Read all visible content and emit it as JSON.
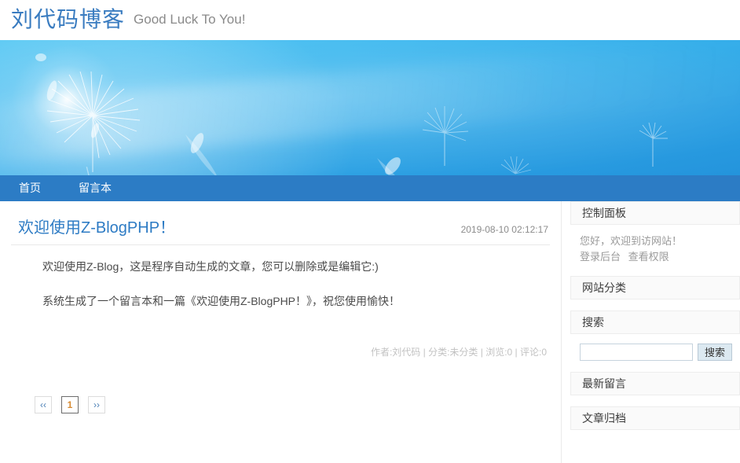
{
  "header": {
    "site_title": "刘代码博客",
    "site_subtitle": "Good Luck To You!"
  },
  "nav": {
    "items": [
      {
        "label": "首页",
        "name": "nav-item-home"
      },
      {
        "label": "留言本",
        "name": "nav-item-guestbook"
      }
    ]
  },
  "article": {
    "title": "欢迎使用Z-BlogPHP！",
    "date": "2019-08-10 02:12:17",
    "paragraphs": [
      "欢迎使用Z-Blog，这是程序自动生成的文章，您可以删除或是编辑它:)",
      "系统生成了一个留言本和一篇《欢迎使用Z-BlogPHP！》，祝您使用愉快！"
    ],
    "meta": "作者:刘代码 | 分类:未分类 | 浏览:0 | 评论:0"
  },
  "pager": {
    "prev": "‹‹",
    "current": "1",
    "next": "››"
  },
  "sidebar": {
    "control_panel": {
      "title": "控制面板",
      "greeting": "您好，欢迎到访网站！",
      "login_link": "登录后台",
      "permission_link": "查看权限"
    },
    "categories": {
      "title": "网站分类"
    },
    "search": {
      "title": "搜索",
      "input_value": "",
      "placeholder": "",
      "button_label": "搜索"
    },
    "latest_comments": {
      "title": "最新留言"
    },
    "archives": {
      "title": "文章归档"
    }
  },
  "colors": {
    "brand_blue": "#3a7cc0",
    "nav_blue": "#2c7cc5",
    "link_blue": "#2d7bc4",
    "banner_top": "#4fc5f3",
    "banner_bottom": "#2494dc",
    "search_button": "#dce9f1",
    "panel_head": "#fafafa",
    "meta_gray": "#c2c2c2"
  }
}
